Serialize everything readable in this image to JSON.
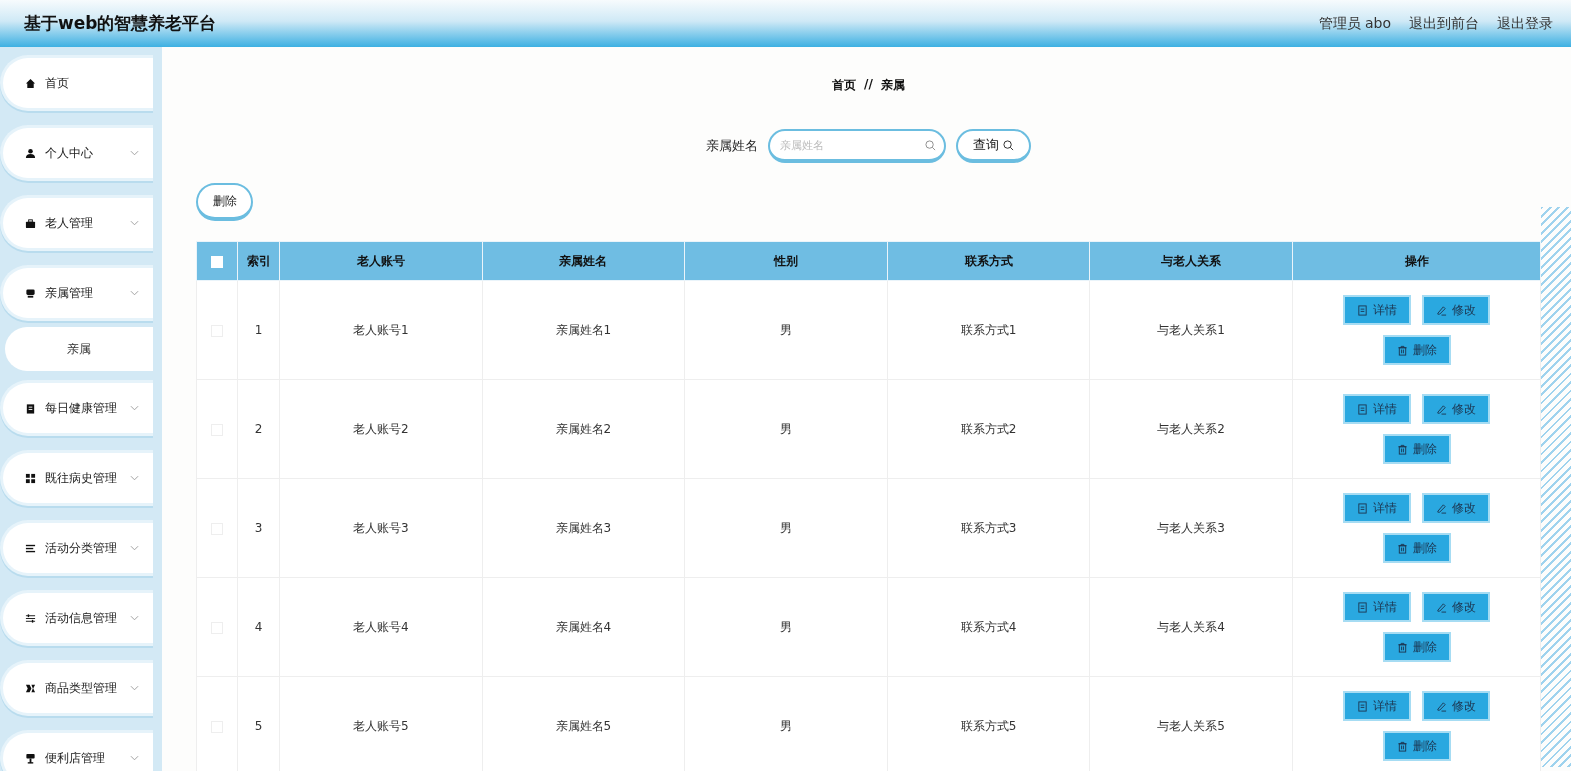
{
  "header": {
    "title": "基于web的智慧养老平台",
    "user": "管理员 abo",
    "links": [
      "退出到前台",
      "退出登录"
    ]
  },
  "sidebar": {
    "items": [
      {
        "label": "首页",
        "kind": "link"
      },
      {
        "label": "个人中心",
        "kind": "menu"
      },
      {
        "label": "老人管理",
        "kind": "menu"
      },
      {
        "label": "亲属管理",
        "kind": "menu",
        "children": [
          {
            "label": "亲属"
          }
        ]
      },
      {
        "label": "每日健康管理",
        "kind": "menu"
      },
      {
        "label": "既往病史管理",
        "kind": "menu"
      },
      {
        "label": "活动分类管理",
        "kind": "menu"
      },
      {
        "label": "活动信息管理",
        "kind": "menu"
      },
      {
        "label": "商品类型管理",
        "kind": "menu"
      },
      {
        "label": "便利店管理",
        "kind": "menu"
      }
    ]
  },
  "breadcrumb": [
    "首页",
    "//",
    "亲属"
  ],
  "search": {
    "label": "亲属姓名",
    "placeholder": "亲属姓名",
    "button": "查询"
  },
  "delete_button": "删除",
  "table": {
    "select_all_checked": false,
    "columns": [
      "索引",
      "老人账号",
      "亲属姓名",
      "性别",
      "联系方式",
      "与老人关系",
      "操作"
    ],
    "rows": [
      {
        "checked": false,
        "cells": [
          "1",
          "老人账号1",
          "亲属姓名1",
          "男",
          "联系方式1",
          "与老人关系1"
        ],
        "actions": [
          {
            "kind": "detail",
            "label": "详情"
          },
          {
            "kind": "edit",
            "label": "修改"
          },
          {
            "kind": "delete",
            "label": "删除"
          }
        ]
      },
      {
        "checked": false,
        "cells": [
          "2",
          "老人账号2",
          "亲属姓名2",
          "男",
          "联系方式2",
          "与老人关系2"
        ],
        "actions": [
          {
            "kind": "detail",
            "label": "详情"
          },
          {
            "kind": "edit",
            "label": "修改"
          },
          {
            "kind": "delete",
            "label": "删除"
          }
        ]
      },
      {
        "checked": false,
        "cells": [
          "3",
          "老人账号3",
          "亲属姓名3",
          "男",
          "联系方式3",
          "与老人关系3"
        ],
        "actions": [
          {
            "kind": "detail",
            "label": "详情"
          },
          {
            "kind": "edit",
            "label": "修改"
          },
          {
            "kind": "delete",
            "label": "删除"
          }
        ]
      },
      {
        "checked": false,
        "cells": [
          "4",
          "老人账号4",
          "亲属姓名4",
          "男",
          "联系方式4",
          "与老人关系4"
        ],
        "actions": [
          {
            "kind": "detail",
            "label": "详情"
          },
          {
            "kind": "edit",
            "label": "修改"
          },
          {
            "kind": "delete",
            "label": "删除"
          }
        ]
      },
      {
        "checked": false,
        "cells": [
          "5",
          "老人账号5",
          "亲属姓名5",
          "男",
          "联系方式5",
          "与老人关系5"
        ],
        "actions": [
          {
            "kind": "detail",
            "label": "详情"
          },
          {
            "kind": "edit",
            "label": "修改"
          },
          {
            "kind": "delete",
            "label": "删除"
          }
        ]
      }
    ]
  }
}
